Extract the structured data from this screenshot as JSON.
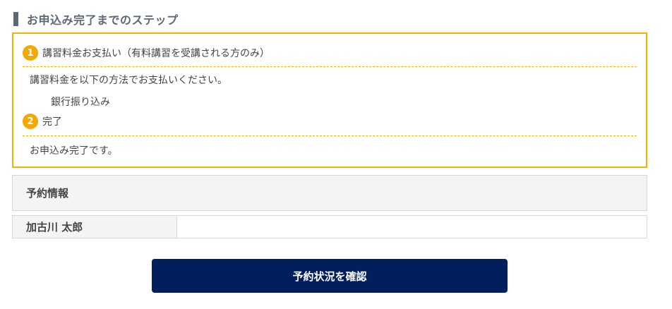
{
  "section_title": "お申込み完了までのステップ",
  "steps": [
    {
      "number": "1",
      "title": "講習料金お支払い（有料講習を受講される方のみ）",
      "description": "講習料金を以下の方法でお支払いください。",
      "method": "銀行振り込み"
    },
    {
      "number": "2",
      "title": "完了",
      "description": "お申込み完了です。"
    }
  ],
  "reservation": {
    "header": "予約情報",
    "name_label": "加古川 太郎",
    "name_value": ""
  },
  "confirm_button_label": "予約状況を確認",
  "colors": {
    "accent": "#f0b400",
    "step_badge": "#f5a800",
    "heading": "#5d6876",
    "button": "#001f5c"
  }
}
